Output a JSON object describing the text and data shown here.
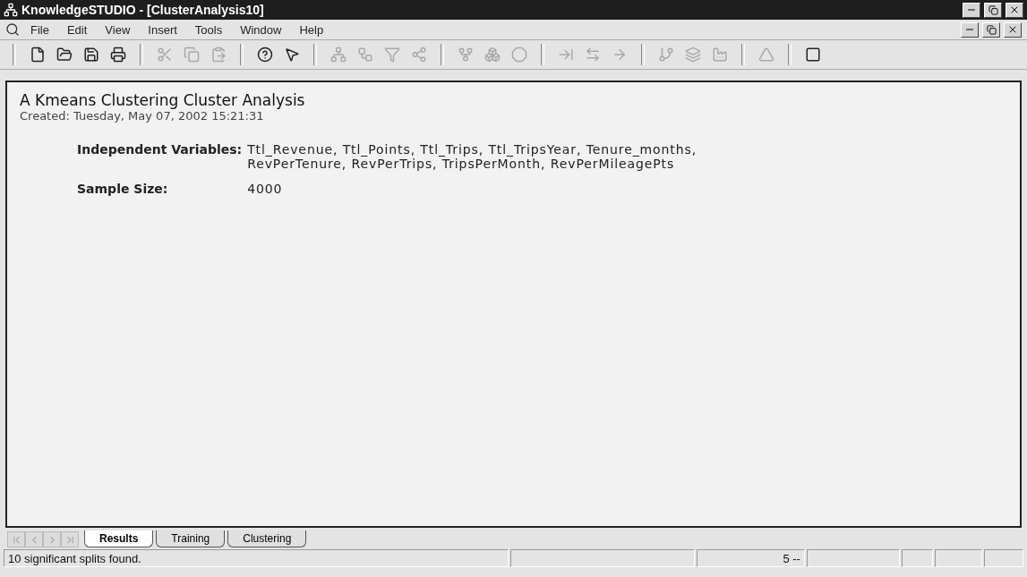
{
  "window": {
    "title": "KnowledgeSTUDIO - [ClusterAnalysis10]"
  },
  "menu": [
    "File",
    "Edit",
    "View",
    "Insert",
    "Tools",
    "Window",
    "Help"
  ],
  "toolbar": [
    [
      {
        "disabled": false
      },
      {
        "disabled": false
      },
      {
        "disabled": false
      },
      {
        "disabled": false
      }
    ],
    [
      {
        "disabled": true
      },
      {
        "disabled": true
      },
      {
        "disabled": true
      }
    ],
    [
      {
        "disabled": false
      },
      {
        "disabled": false
      }
    ],
    [
      {
        "disabled": true
      },
      {
        "disabled": true
      },
      {
        "disabled": true
      },
      {
        "disabled": true
      }
    ],
    [
      {
        "disabled": true
      },
      {
        "disabled": true
      },
      {
        "disabled": true
      }
    ],
    [
      {
        "disabled": true
      },
      {
        "disabled": true
      },
      {
        "disabled": true
      }
    ],
    [
      {
        "disabled": true
      },
      {
        "disabled": true
      },
      {
        "disabled": true
      }
    ],
    [
      {
        "disabled": true
      }
    ],
    [
      {
        "disabled": false
      }
    ]
  ],
  "report": {
    "title": "A Kmeans Clustering Cluster Analysis",
    "created": "Created: Tuesday, May 07, 2002 15:21:31",
    "fields": [
      {
        "label": "Independent Variables:",
        "value": "Ttl_Revenue, Ttl_Points, Ttl_Trips, Ttl_TripsYear, Tenure_months, RevPerTenure, RevPerTrips, TripsPerMonth, RevPerMileagePts"
      },
      {
        "label": "Sample Size:",
        "value": "4000"
      }
    ]
  },
  "tab_nav": [
    {
      "disabled": true
    },
    {
      "disabled": true
    },
    {
      "disabled": true
    },
    {
      "disabled": true
    }
  ],
  "tabs": [
    {
      "label": "Results",
      "selected": true
    },
    {
      "label": "Training",
      "selected": false
    },
    {
      "label": "Clustering",
      "selected": false
    }
  ],
  "status_bar": {
    "message": "10 significant splits found.",
    "panes": [
      "5 --"
    ]
  }
}
